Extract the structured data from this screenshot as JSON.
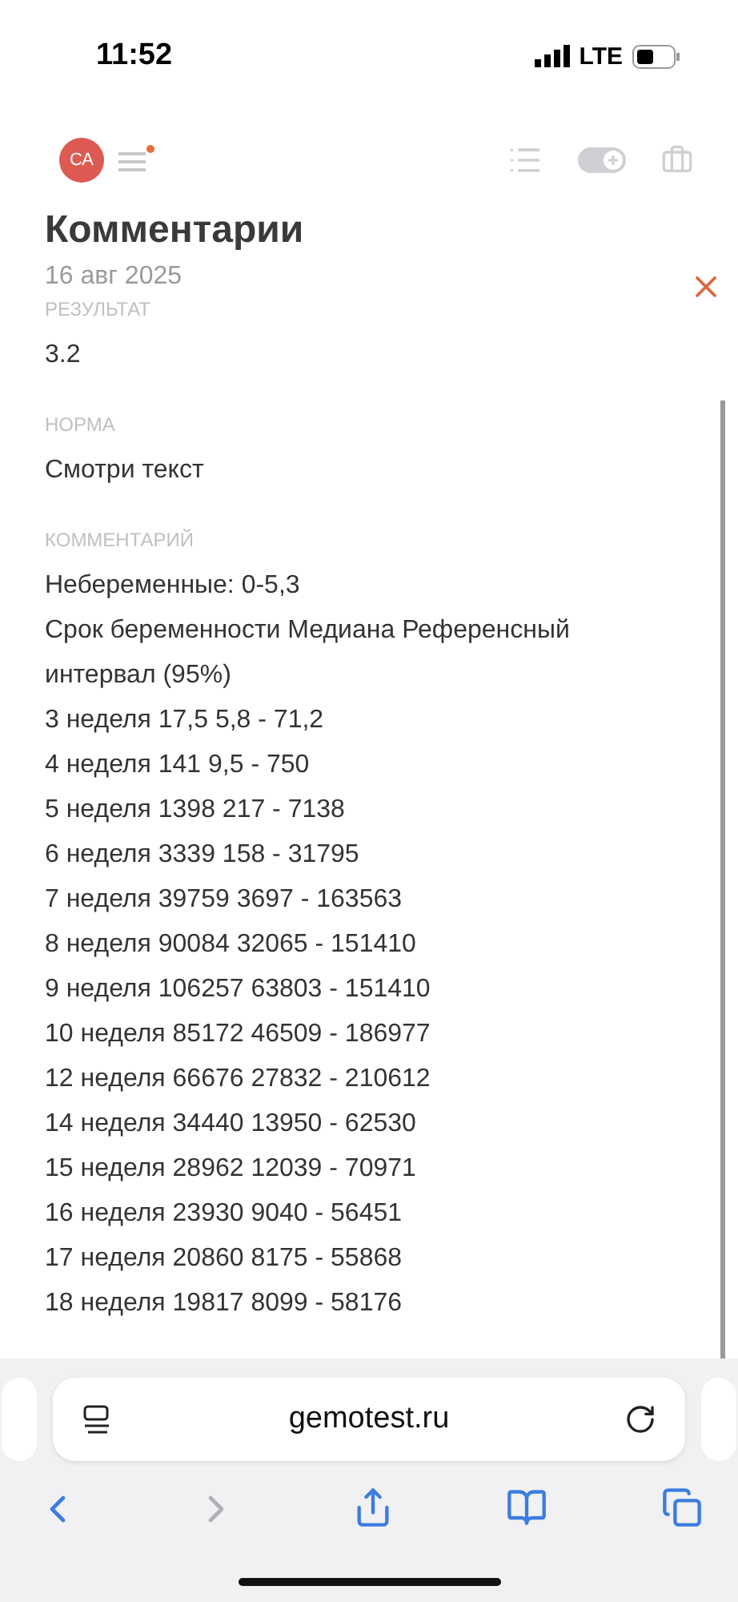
{
  "status_bar": {
    "time": "11:52",
    "network": "LTE"
  },
  "header": {
    "avatar": "СА",
    "menu_notification": true
  },
  "page": {
    "title": "Комментарии",
    "date": "16 авг 2025",
    "sections": [
      {
        "label": "РЕЗУЛЬТАТ",
        "lines": [
          "3.2"
        ]
      },
      {
        "label": "НОРМА",
        "lines": [
          "Смотри текст"
        ]
      },
      {
        "label": "КОММЕНТАРИЙ",
        "lines": [
          "Небеременные: 0-5,3",
          "Срок беременности Медиана Референсный интервал (95%)",
          "3 неделя 17,5 5,8 - 71,2",
          "4 неделя 141 9,5 - 750",
          "5 неделя 1398 217 - 7138",
          "6 неделя 3339 158 - 31795",
          "7 неделя 39759 3697 - 163563",
          "8 неделя 90084 32065 - 151410",
          "9 неделя 106257 63803 - 151410",
          "10 неделя 85172 46509 - 186977",
          "12 неделя 66676 27832 - 210612",
          "14 неделя 34440 13950 - 62530",
          "15 неделя 28962 12039 - 70971",
          "16 неделя 23930 9040 - 56451",
          "17 неделя 20860 8175 - 55868",
          "18 неделя 19817 8099 - 58176"
        ]
      }
    ]
  },
  "browser": {
    "url": "gemotest.ru",
    "back_disabled": false,
    "forward_disabled": true
  }
}
